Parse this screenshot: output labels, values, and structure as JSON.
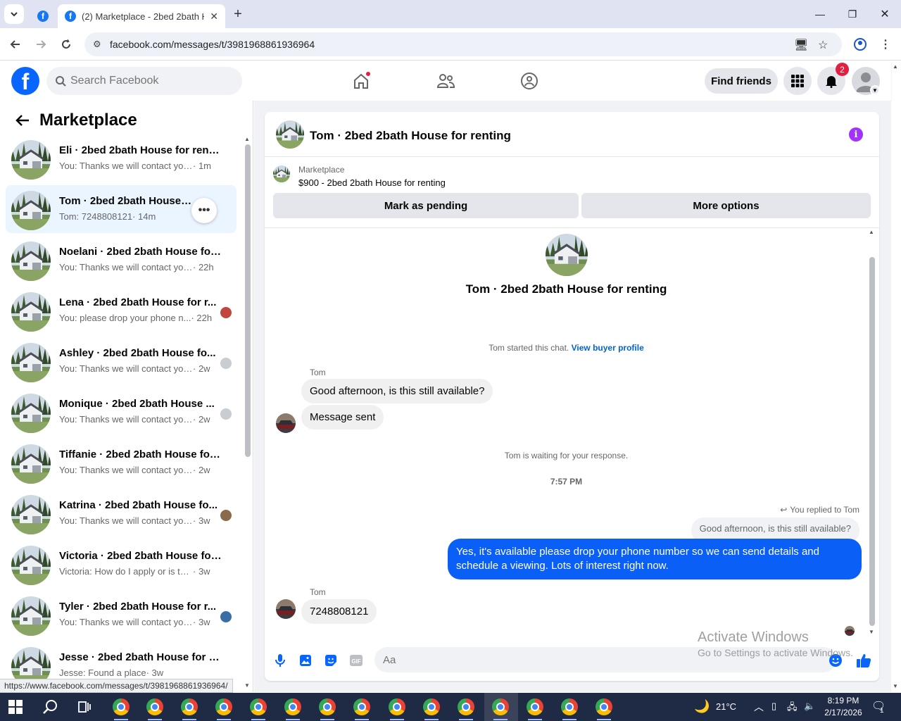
{
  "browser": {
    "tab_title": "(2) Marketplace - 2bed 2bath H",
    "url": "facebook.com/messages/t/3981968861936964",
    "status_url": "https://www.facebook.com/messages/t/3981968861936964/"
  },
  "header": {
    "search_placeholder": "Search Facebook",
    "find_friends": "Find friends",
    "notif_count": "2"
  },
  "sidebar": {
    "title": "Marketplace",
    "conversations": [
      {
        "name": "Eli · 2bed 2bath House for renting",
        "preview": "You: Thanks we will contact you so...",
        "time": "· 1m"
      },
      {
        "name": "Tom · 2bed 2bath House for renting",
        "preview": "Tom: 7248808121",
        "time": "· 14m"
      },
      {
        "name": "Noelani · 2bed 2bath House for ...",
        "preview": "You: Thanks we will contact you s...",
        "time": "· 22h"
      },
      {
        "name": "Lena · 2bed 2bath House for r...",
        "preview": "You: please drop your phone n...",
        "time": "· 22h"
      },
      {
        "name": "Ashley · 2bed 2bath House fo...",
        "preview": "You: Thanks we will contact you ...",
        "time": "· 2w"
      },
      {
        "name": "Monique · 2bed 2bath House ...",
        "preview": "You: Thanks we will contact you ...",
        "time": "· 2w"
      },
      {
        "name": "Tiffanie · 2bed 2bath House for ...",
        "preview": "You: Thanks we will contact you so...",
        "time": "· 2w"
      },
      {
        "name": "Katrina · 2bed 2bath House fo...",
        "preview": "You: Thanks we will contact you ...",
        "time": "· 3w"
      },
      {
        "name": "Victoria · 2bed 2bath House for ...",
        "preview": "Victoria: How do I apply or is this p...",
        "time": "· 3w"
      },
      {
        "name": "Tyler · 2bed 2bath House for r...",
        "preview": "You: Thanks we will contact you ...",
        "time": "· 3w"
      },
      {
        "name": "Jesse · 2bed 2bath House for re...",
        "preview": "Jesse: Found a place",
        "time": "· 3w"
      }
    ]
  },
  "chat": {
    "title": "Tom · 2bed 2bath House for renting",
    "marketplace_label": "Marketplace",
    "listing": "$900 - 2bed 2bath House for renting",
    "mark_pending": "Mark as pending",
    "more_options": "More options",
    "hero_name": "Tom · 2bed 2bath House for renting",
    "started_text": "Tom started this chat.",
    "view_profile": "View buyer profile",
    "sender_name": "Tom",
    "msg1": "Good afternoon, is this still available?",
    "msg2": "Message sent",
    "waiting_text": "Tom is waiting for your response.",
    "timestamp": "7:57 PM",
    "replied_note": "You replied to Tom",
    "quoted": "Good afternoon, is this still available?",
    "my_reply": "Yes, it's available please drop your phone number so we can send details and schedule a viewing. Lots of interest right now.",
    "sender_name2": "Tom",
    "msg3": "7248808121",
    "composer_placeholder": "Aa"
  },
  "watermark": {
    "line1": "Activate Windows",
    "line2": "Go to Settings to activate Windows."
  },
  "taskbar": {
    "temperature": "21°C",
    "time": "8:19 PM",
    "date": "2/17/2026",
    "notif_count": "1"
  }
}
